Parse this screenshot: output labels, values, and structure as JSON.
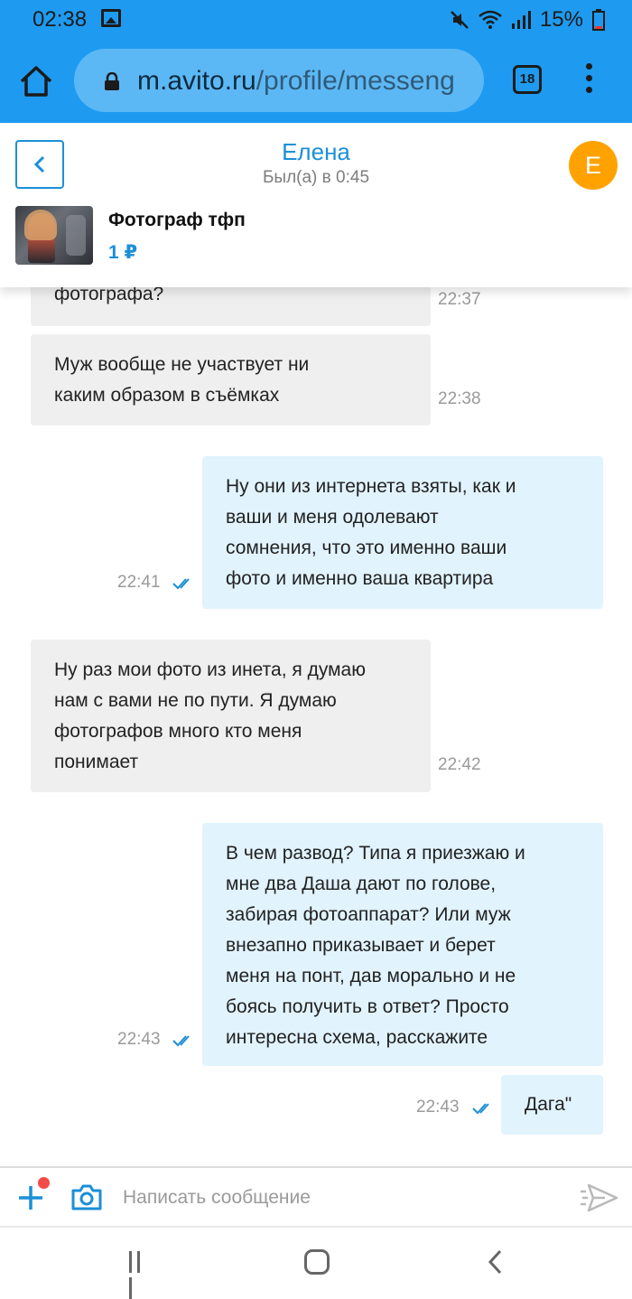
{
  "status_bar": {
    "time": "02:38",
    "battery": "15%",
    "icons": [
      "image-icon",
      "mute-icon",
      "wifi-icon",
      "signal-icon",
      "battery-icon"
    ]
  },
  "browser": {
    "url_host": "m.avito.ru",
    "url_path": "/profile/messeng",
    "tab_count": "18",
    "icons": [
      "home-icon",
      "lock-icon",
      "more-vert-icon"
    ]
  },
  "chat_header": {
    "contact_name": "Елена",
    "last_seen": "Был(а) в 0:45",
    "avatar_letter": "E",
    "avatar_color": "#ffa200",
    "item_title": "Фотограф тфп",
    "item_price": "1 ₽"
  },
  "messages": [
    {
      "direction": "in",
      "lines": [
        "фотографа?"
      ],
      "time": "22:37"
    },
    {
      "direction": "in",
      "lines": [
        "Муж вообще не участвует ни",
        "каким образом в съёмках"
      ],
      "time": "22:38"
    },
    {
      "direction": "out",
      "lines": [
        "Ну они из интернета взяты, как и",
        "ваши и меня одолевают",
        "сомнения, что это именно ваши",
        "фото и именно ваша квартира"
      ],
      "time": "22:41",
      "read": true
    },
    {
      "direction": "in",
      "lines": [
        "Ну раз мои фото из инета, я думаю",
        "нам с вами не по пути. Я думаю",
        "фотографов много кто меня",
        "понимает"
      ],
      "time": "22:42"
    },
    {
      "direction": "out",
      "lines": [
        "В чем развод? Типа я приезжаю и",
        "мне два Даша дают по голове,",
        "забирая фотоаппарат? Или муж",
        "внезапно приказывает и берет",
        "меня на понт, дав морально и не",
        "боясь получить в ответ? Просто",
        "интересна схема, расскажите"
      ],
      "time": "22:43",
      "read": true
    },
    {
      "direction": "out",
      "lines": [
        "Дага\""
      ],
      "time": "22:43",
      "read": true
    }
  ],
  "composer": {
    "placeholder": "Написать сообщение",
    "value": "",
    "icons": [
      "plus-icon",
      "camera-icon",
      "send-icon"
    ]
  },
  "colors": {
    "brand_blue": "#1e9bf0",
    "accent": "#1b8fd8",
    "incoming_bubble": "#efefef",
    "outgoing_bubble": "#e1f3fd",
    "notification_dot": "#f24a46"
  }
}
